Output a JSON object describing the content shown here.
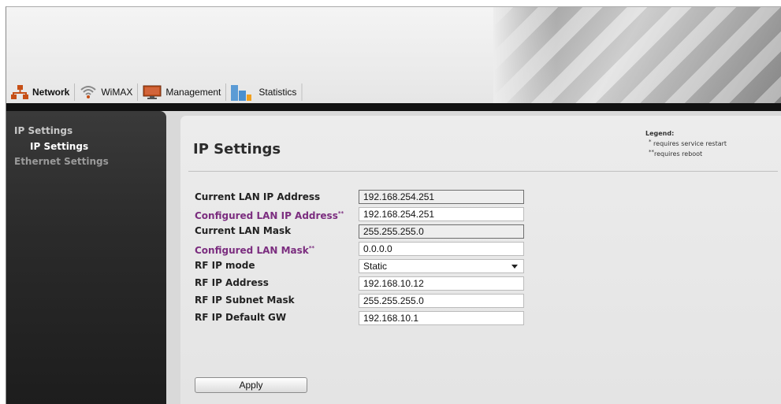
{
  "nav": {
    "items": [
      {
        "label": "Network",
        "icon": "network-icon",
        "active": true
      },
      {
        "label": "WiMAX",
        "icon": "wifi-icon",
        "active": false
      },
      {
        "label": "Management",
        "icon": "monitor-icon",
        "active": false
      },
      {
        "label": "Statistics",
        "icon": "bar-chart-icon",
        "active": false
      }
    ]
  },
  "sidebar": {
    "section": "IP Settings",
    "sub_item": "IP Settings",
    "other_item": "Ethernet Settings"
  },
  "page": {
    "title": "IP Settings",
    "legend_title": "Legend:",
    "legend_restart_mark": "*",
    "legend_restart_text": "requires service restart",
    "legend_reboot_mark": "**",
    "legend_reboot_text": "requires reboot"
  },
  "form": {
    "current_lan_ip_label": "Current LAN IP Address",
    "current_lan_ip_value": "192.168.254.251",
    "configured_lan_ip_label": "Configured LAN IP Address",
    "configured_lan_ip_mark": "**",
    "configured_lan_ip_value": "192.168.254.251",
    "current_lan_mask_label": "Current LAN Mask",
    "current_lan_mask_value": "255.255.255.0",
    "configured_lan_mask_label": "Configured LAN Mask",
    "configured_lan_mask_mark": "**",
    "configured_lan_mask_value": "0.0.0.0",
    "rf_ip_mode_label": "RF IP mode",
    "rf_ip_mode_value": "Static",
    "rf_ip_address_label": "RF IP Address",
    "rf_ip_address_value": "192.168.10.12",
    "rf_ip_subnet_label": "RF IP Subnet Mask",
    "rf_ip_subnet_value": "255.255.255.0",
    "rf_ip_gw_label": "RF IP Default GW",
    "rf_ip_gw_value": "192.168.10.1",
    "apply_label": "Apply"
  },
  "colors": {
    "configured_label": "#7b2d7f",
    "network_icon": "#c64f16",
    "sidebar_bg": "#2b2b2b"
  }
}
